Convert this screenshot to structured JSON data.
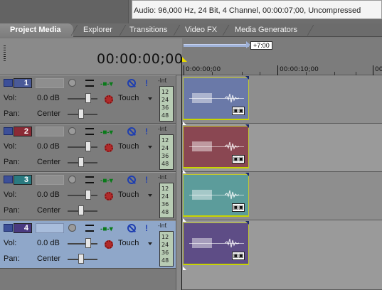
{
  "media_info": {
    "text": "Audio: 96,000 Hz, 24 Bit, 4 Channel, 00:00:07;00, Uncompressed"
  },
  "tabs": [
    {
      "label": "Project Media",
      "active": true
    },
    {
      "label": "Explorer",
      "active": false
    },
    {
      "label": "Transitions",
      "active": false
    },
    {
      "label": "Video FX",
      "active": false
    },
    {
      "label": "Media Generators",
      "active": false
    }
  ],
  "timeline": {
    "timecode": "00:00:00;00",
    "loop_duration": "+7:00",
    "ruler_labels": [
      "0:00:00;00",
      "00:00:10;00",
      "00:"
    ]
  },
  "tracks": [
    {
      "number": "1",
      "vol_label": "Vol:",
      "vol_value": "0.0 dB",
      "pan_label": "Pan:",
      "pan_value": "Center",
      "automation": "Touch",
      "meter_top": "-Inf.",
      "meter_scale": [
        "12",
        "24",
        "36",
        "48"
      ],
      "color": "#4a5a98",
      "clip_color": "#6a79a8",
      "selected": false
    },
    {
      "number": "2",
      "vol_label": "Vol:",
      "vol_value": "0.0 dB",
      "pan_label": "Pan:",
      "pan_value": "Center",
      "automation": "Touch",
      "meter_top": "-Inf.",
      "meter_scale": [
        "12",
        "24",
        "36",
        "48"
      ],
      "color": "#8a2a35",
      "clip_color": "#8a4752",
      "selected": false
    },
    {
      "number": "3",
      "vol_label": "Vol:",
      "vol_value": "0.0 dB",
      "pan_label": "Pan:",
      "pan_value": "Center",
      "automation": "Touch",
      "meter_top": "-Inf.",
      "meter_scale": [
        "12",
        "24",
        "36",
        "48"
      ],
      "color": "#2a7a80",
      "clip_color": "#5c9c9b",
      "selected": false
    },
    {
      "number": "4",
      "vol_label": "Vol:",
      "vol_value": "0.0 dB",
      "pan_label": "Pan:",
      "pan_value": "Center",
      "automation": "Touch",
      "meter_top": "-Inf.",
      "meter_scale": [
        "12",
        "24",
        "36",
        "48"
      ],
      "color": "#4a3a80",
      "clip_color": "#5e4d86",
      "selected": true
    }
  ],
  "clip_icon_glyph": "▣▣"
}
